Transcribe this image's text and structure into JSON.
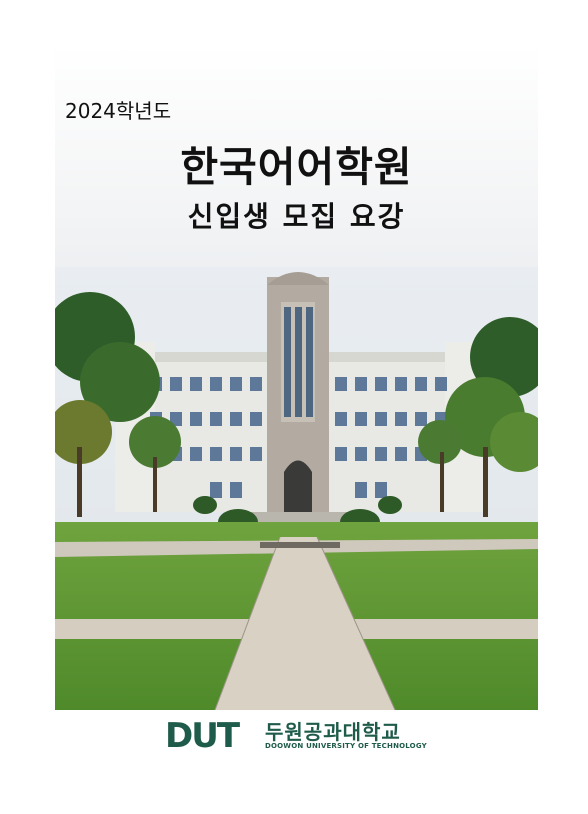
{
  "header": {
    "year": "2024학년도",
    "title": "한국어어학원",
    "subtitle": "신입생 모집 요강"
  },
  "footer": {
    "logo_text": "DUT",
    "university_name_ko": "두원공과대학교",
    "university_name_en": "DOOWON UNIVERSITY OF TECHNOLOGY"
  },
  "colors": {
    "brand": "#1f5b4a"
  }
}
